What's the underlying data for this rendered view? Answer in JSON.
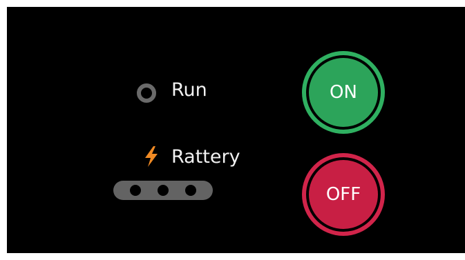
{
  "status": {
    "run_label": "Run",
    "battery_label": "Rattery"
  },
  "icons": {
    "run_indicator": "ring-indicator",
    "battery": "lightning-bolt-icon"
  },
  "battery": {
    "dots": 3
  },
  "controls": {
    "on_label": "ON",
    "off_label": "OFF"
  },
  "colors": {
    "background": "#000000",
    "on": "#2ca45a",
    "off": "#c81f44",
    "bolt": "#f08a24",
    "indicator": "#6a6a6a",
    "text": "#f2f2f2"
  }
}
